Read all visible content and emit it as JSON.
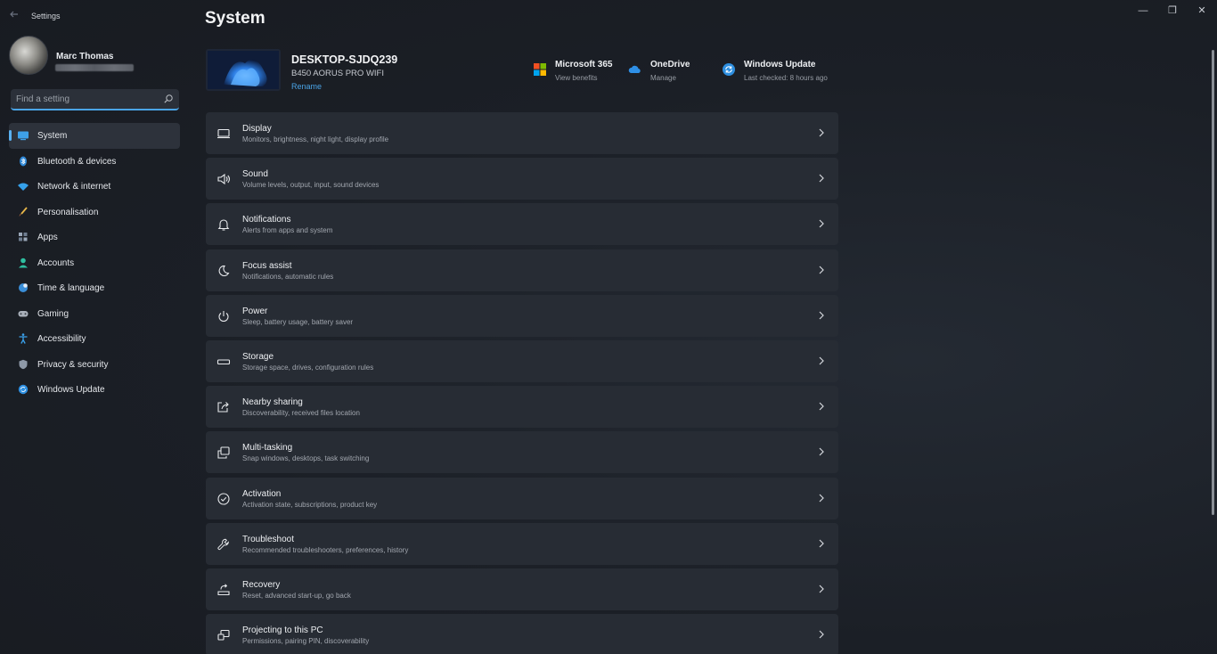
{
  "window": {
    "app_title": "Settings",
    "back_icon": "back-arrow-icon",
    "minimize_glyph": "—",
    "maximize_glyph": "❐",
    "close_glyph": "✕"
  },
  "user": {
    "name": "Marc Thomas"
  },
  "search": {
    "placeholder": "Find a setting",
    "value": ""
  },
  "sidebar": {
    "items": [
      {
        "label": "System",
        "icon": "system-icon",
        "active": true
      },
      {
        "label": "Bluetooth & devices",
        "icon": "bluetooth-icon"
      },
      {
        "label": "Network & internet",
        "icon": "wifi-icon"
      },
      {
        "label": "Personalisation",
        "icon": "brush-icon"
      },
      {
        "label": "Apps",
        "icon": "apps-icon"
      },
      {
        "label": "Accounts",
        "icon": "person-icon"
      },
      {
        "label": "Time & language",
        "icon": "globe-clock-icon"
      },
      {
        "label": "Gaming",
        "icon": "gamepad-icon"
      },
      {
        "label": "Accessibility",
        "icon": "accessibility-icon"
      },
      {
        "label": "Privacy & security",
        "icon": "shield-icon"
      },
      {
        "label": "Windows Update",
        "icon": "update-icon"
      }
    ]
  },
  "main": {
    "title": "System",
    "device": {
      "name": "DESKTOP-SJDQ239",
      "model": "B450 AORUS PRO WIFI",
      "rename_label": "Rename"
    },
    "quick_links": [
      {
        "title": "Microsoft 365",
        "subtitle": "View benefits",
        "icon": "microsoft-logo-icon"
      },
      {
        "title": "OneDrive",
        "subtitle": "Manage",
        "icon": "cloud-icon"
      },
      {
        "title": "Windows Update",
        "subtitle": "Last checked: 8 hours ago",
        "icon": "update-icon"
      }
    ],
    "cards": [
      {
        "title": "Display",
        "subtitle": "Monitors, brightness, night light, display profile",
        "icon": "monitor-icon"
      },
      {
        "title": "Sound",
        "subtitle": "Volume levels, output, input, sound devices",
        "icon": "speaker-icon"
      },
      {
        "title": "Notifications",
        "subtitle": "Alerts from apps and system",
        "icon": "bell-icon"
      },
      {
        "title": "Focus assist",
        "subtitle": "Notifications, automatic rules",
        "icon": "moon-icon"
      },
      {
        "title": "Power",
        "subtitle": "Sleep, battery usage, battery saver",
        "icon": "power-icon"
      },
      {
        "title": "Storage",
        "subtitle": "Storage space, drives, configuration rules",
        "icon": "drive-icon"
      },
      {
        "title": "Nearby sharing",
        "subtitle": "Discoverability, received files location",
        "icon": "share-icon"
      },
      {
        "title": "Multi-tasking",
        "subtitle": "Snap windows, desktops, task switching",
        "icon": "multitask-icon"
      },
      {
        "title": "Activation",
        "subtitle": "Activation state, subscriptions, product key",
        "icon": "check-circle-icon"
      },
      {
        "title": "Troubleshoot",
        "subtitle": "Recommended troubleshooters, preferences, history",
        "icon": "wrench-icon"
      },
      {
        "title": "Recovery",
        "subtitle": "Reset, advanced start-up, go back",
        "icon": "recovery-icon"
      },
      {
        "title": "Projecting to this PC",
        "subtitle": "Permissions, pairing PIN, discoverability",
        "icon": "projector-icon"
      }
    ]
  },
  "colors": {
    "accent": "#4aa4e6",
    "background": "#1c2027",
    "card": "#272c34"
  }
}
